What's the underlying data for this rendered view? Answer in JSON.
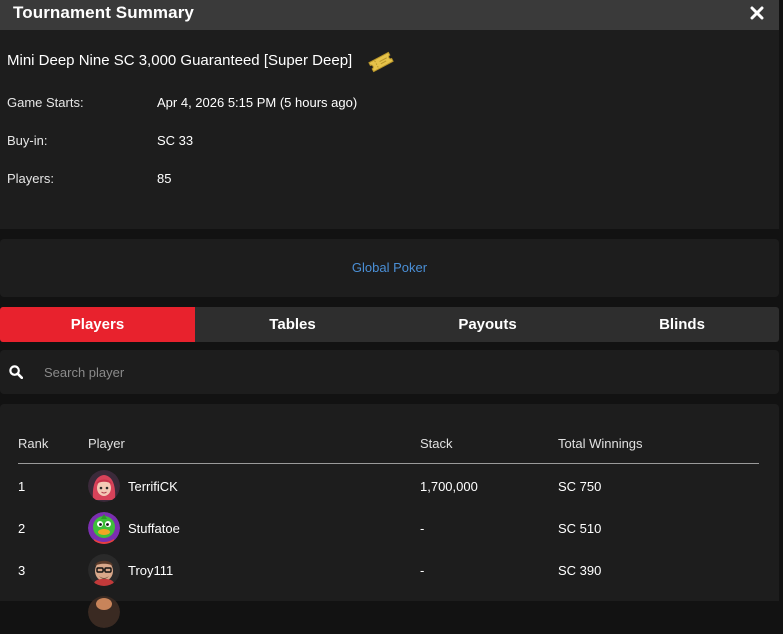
{
  "header": {
    "title": "Tournament Summary",
    "close_icon": "close-icon"
  },
  "summary": {
    "tournament_name": "Mini Deep Nine SC 3,000 Guaranteed [Super Deep]",
    "ticket_icon": "ticket-icon",
    "game_starts_label": "Game Starts:",
    "game_starts_value": "Apr 4, 2026 5:15 PM (5 hours ago)",
    "buyin_label": "Buy-in:",
    "buyin_value": "SC 33",
    "players_label": "Players:",
    "players_value": "85"
  },
  "site": {
    "link_text": "Global Poker"
  },
  "tabs": [
    {
      "label": "Players",
      "active": true
    },
    {
      "label": "Tables",
      "active": false
    },
    {
      "label": "Payouts",
      "active": false
    },
    {
      "label": "Blinds",
      "active": false
    }
  ],
  "search": {
    "icon": "search-icon",
    "placeholder": "Search player",
    "value": ""
  },
  "table": {
    "columns": {
      "rank": "Rank",
      "player": "Player",
      "stack": "Stack",
      "winnings": "Total Winnings"
    },
    "rows": [
      {
        "rank": "1",
        "player": "TerrifiCK",
        "stack": "1,700,000",
        "winnings": "SC 750",
        "avatar": "avatar-red-hair-girl"
      },
      {
        "rank": "2",
        "player": "Stuffatoe",
        "stack": "-",
        "winnings": "SC 510",
        "avatar": "avatar-green-duck"
      },
      {
        "rank": "3",
        "player": "Troy111",
        "stack": "-",
        "winnings": "SC 390",
        "avatar": "avatar-man-glasses"
      }
    ]
  },
  "colors": {
    "accent_active_tab": "#e8222d",
    "link": "#4a8fd6",
    "panel_bg": "#1d1d1d",
    "page_bg": "#121212",
    "titlebar_bg": "#3a3a3a"
  }
}
